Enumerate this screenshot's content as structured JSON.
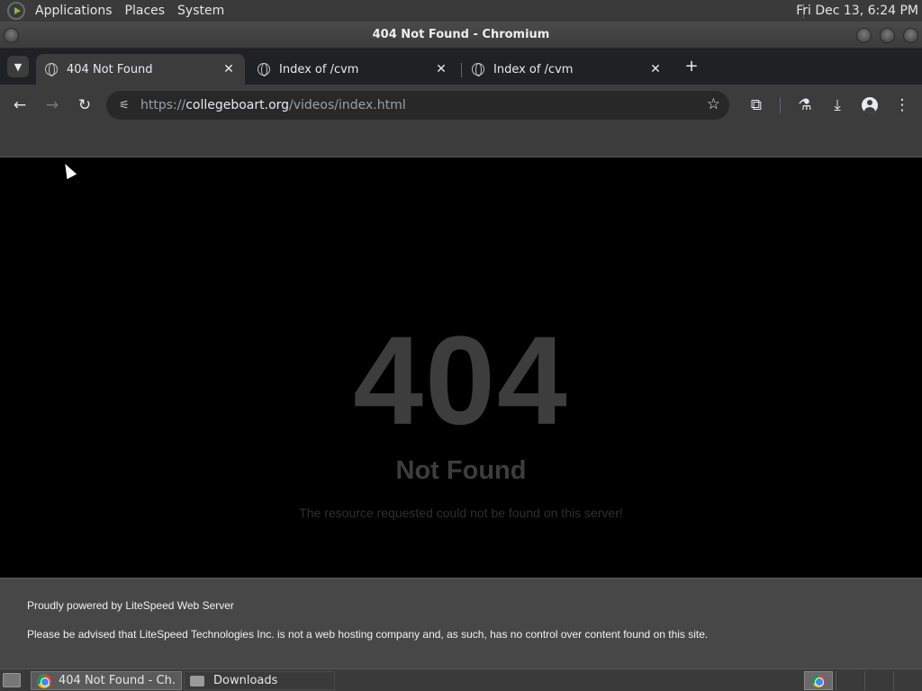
{
  "top_panel": {
    "menus": [
      "Applications",
      "Places",
      "System"
    ],
    "clock": "Fri Dec 13,  6:24 PM"
  },
  "window": {
    "title": "404 Not Found - Chromium"
  },
  "tabs": [
    {
      "title": "404 Not Found",
      "active": true
    },
    {
      "title": "Index of /cvm",
      "active": false
    },
    {
      "title": "Index of /cvm",
      "active": false
    }
  ],
  "toolbar": {
    "url_scheme": "https://",
    "url_host": "collegeboart.org",
    "url_path": "/videos/index.html",
    "icons": [
      "back-icon",
      "forward-icon",
      "reload-icon",
      "site-settings-icon",
      "bookmark-star-icon",
      "extensions-icon",
      "labs-icon",
      "download-icon",
      "profile-icon",
      "menu-icon"
    ]
  },
  "page": {
    "error_code": "404",
    "error_title": "Not Found",
    "error_message": "The resource requested could not be found on this server!",
    "footer_powered": "Proudly powered by LiteSpeed Web Server",
    "footer_notice": "Please be advised that LiteSpeed Technologies Inc. is not a web hosting company and, as such, has no control over content found on this site."
  },
  "taskbar": {
    "tasks": [
      {
        "label": "404 Not Found - Ch...",
        "active": true
      },
      {
        "label": "Downloads",
        "active": false
      }
    ]
  },
  "colors": {
    "panel": "#3a3a3a",
    "tabstrip": "#202124",
    "toolbar": "#3c3c3c",
    "page_bg": "#000000",
    "error_text": "#3d3d3d",
    "footer_bg": "#474747"
  }
}
